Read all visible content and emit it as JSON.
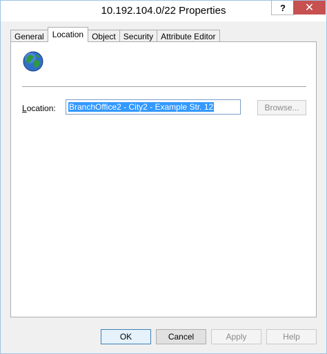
{
  "window": {
    "title": "10.192.104.0/22 Properties"
  },
  "title_buttons": {
    "help": "?",
    "close": "✕"
  },
  "tabs": [
    {
      "label": "General"
    },
    {
      "label": "Location"
    },
    {
      "label": "Object"
    },
    {
      "label": "Security"
    },
    {
      "label": "Attribute Editor"
    }
  ],
  "location_tab": {
    "icon": "globe-icon",
    "label_prefix": "",
    "label_access_key": "L",
    "label_rest": "ocation:",
    "value": "BranchOffice2 - City2 - Example Str. 12",
    "browse_label": "Browse..."
  },
  "footer": {
    "ok": "OK",
    "cancel": "Cancel",
    "apply": "Apply",
    "help": "Help"
  },
  "colors": {
    "selection": "#3399ff",
    "close_button": "#c75050",
    "window_border": "#9cc4e4"
  }
}
